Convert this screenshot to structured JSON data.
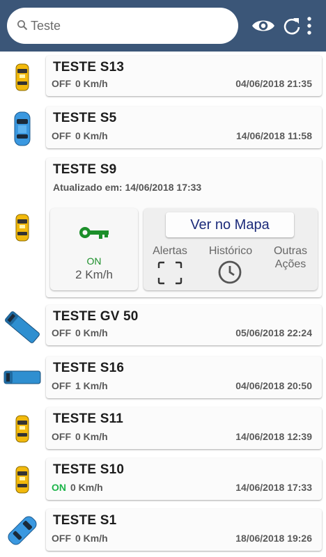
{
  "search": {
    "value": "",
    "placeholder": "Teste"
  },
  "colors": {
    "topbar": "#3b5678",
    "on": "#1db54a",
    "key": "#1c8f2a",
    "button_text": "#1b2a7a"
  },
  "header_icons": [
    "search-icon",
    "eye-icon",
    "refresh-icon",
    "more-vert-icon"
  ],
  "vehicles": [
    {
      "name": "TESTE S13",
      "status": "OFF",
      "speed": "0 Km/h",
      "date": "04/06/2018 21:35",
      "icon": "taxi-icon"
    },
    {
      "name": "TESTE S5",
      "status": "OFF",
      "speed": "0 Km/h",
      "date": "14/06/2018 11:58",
      "icon": "blue-car-icon"
    },
    {
      "name": "TESTE S9",
      "updated": "Atualizado em: 14/06/2018 17:33",
      "ignition": "ON",
      "speed": "2 Km/h",
      "map_button": "Ver no Mapa",
      "actions": {
        "alerts": "Alertas",
        "history": "Histórico",
        "other": "Outras Ações"
      },
      "icon": "taxi-icon"
    },
    {
      "name": "TESTE GV 50",
      "status": "OFF",
      "speed": "0 Km/h",
      "date": "05/06/2018 22:24",
      "icon": "truck-icon"
    },
    {
      "name": "TESTE S16",
      "status": "OFF",
      "speed": "1 Km/h",
      "date": "04/06/2018 20:50",
      "icon": "truck-icon"
    },
    {
      "name": "TESTE S11",
      "status": "OFF",
      "speed": "0 Km/h",
      "date": "14/06/2018 12:39",
      "icon": "taxi-icon"
    },
    {
      "name": "TESTE S10",
      "status": "ON",
      "speed": "0 Km/h",
      "date": "14/06/2018 17:33",
      "icon": "taxi-icon"
    },
    {
      "name": "TESTE S1",
      "status": "OFF",
      "speed": "0 Km/h",
      "date": "18/06/2018 19:26",
      "icon": "blue-car-icon"
    }
  ]
}
